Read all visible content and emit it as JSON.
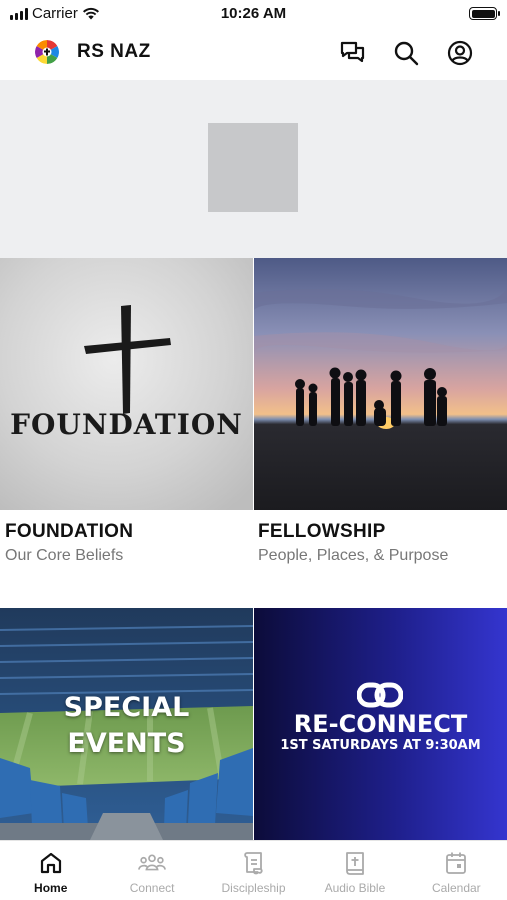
{
  "status_bar": {
    "carrier": "Carrier",
    "time": "10:26 AM"
  },
  "header": {
    "title": "RS NAZ",
    "icons": [
      "chat-icon",
      "search-icon",
      "profile-icon"
    ]
  },
  "tiles": [
    {
      "title": "FOUNDATION",
      "subtitle": "Our Core Beliefs",
      "image_text": "FOUNDATION"
    },
    {
      "title": "FELLOWSHIP",
      "subtitle": "People, Places, & Purpose"
    },
    {
      "image_text_line1": "SPECIAL",
      "image_text_line2": "EVENTS"
    },
    {
      "image_title": "RE-CONNECT",
      "image_subtitle": "1ST SATURDAYS AT 9:30AM"
    }
  ],
  "tab_bar": {
    "items": [
      {
        "label": "Home",
        "icon": "home-icon",
        "active": true
      },
      {
        "label": "Connect",
        "icon": "people-icon",
        "active": false
      },
      {
        "label": "Discipleship",
        "icon": "scroll-icon",
        "active": false
      },
      {
        "label": "Audio Bible",
        "icon": "bible-icon",
        "active": false
      },
      {
        "label": "Calendar",
        "icon": "calendar-icon",
        "active": false
      }
    ]
  },
  "colors": {
    "active_tab": "#111111",
    "inactive_tab": "#aaaaaa",
    "banner_bg": "#eeeff1",
    "reconnect_blue": "#2c2ec4"
  }
}
